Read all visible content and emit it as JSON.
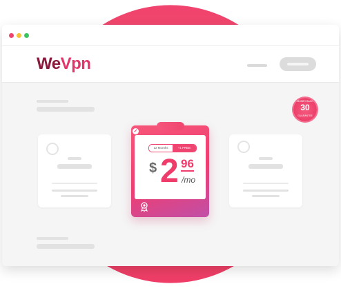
{
  "brand": {
    "logo_main": "We",
    "logo_accent": "Vpn"
  },
  "window_dots": [
    "#f0436e",
    "#f5c23a",
    "#3ac561"
  ],
  "badge": {
    "number": "30",
    "top_text": "MONEY BACK",
    "bottom_text": "GUARANTEE"
  },
  "plan": {
    "toggle_options": [
      "12 Months",
      "+1 FREE"
    ],
    "currency": "$",
    "price_whole": "2",
    "price_cents": "96",
    "period": "/mo"
  },
  "colors": {
    "accent": "#ee3d6a",
    "brand_dark": "#8a1a3c"
  }
}
